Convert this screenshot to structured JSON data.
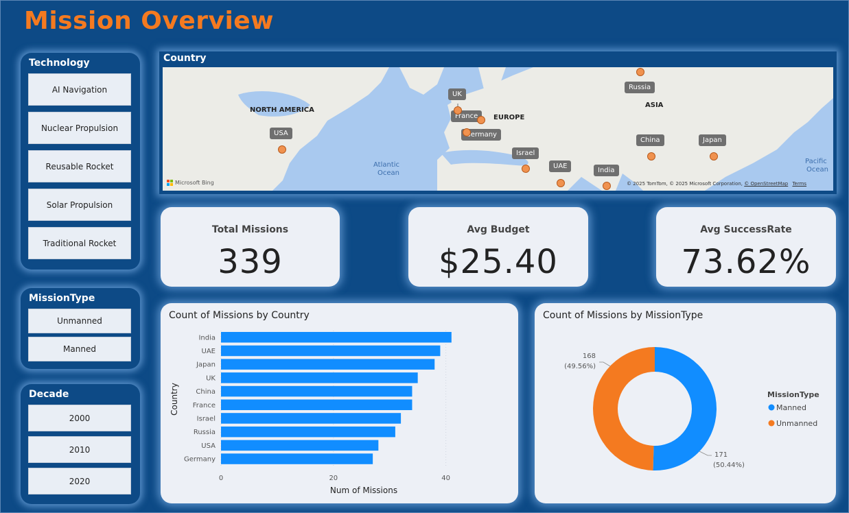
{
  "title": "Mission Overview",
  "slicers": {
    "technology": {
      "header": "Technology",
      "items": [
        "AI Navigation",
        "Nuclear Propulsion",
        "Reusable Rocket",
        "Solar Propulsion",
        "Traditional Rocket"
      ]
    },
    "mission_type": {
      "header": "MissionType",
      "items": [
        "Unmanned",
        "Manned"
      ]
    },
    "decade": {
      "header": "Decade",
      "items": [
        "2000",
        "2010",
        "2020"
      ]
    }
  },
  "map": {
    "header": "Country",
    "regions": [
      "NORTH AMERICA",
      "EUROPE",
      "ASIA"
    ],
    "oceans": [
      "Atlantic",
      "Ocean",
      "Pacific",
      "Ocean"
    ],
    "countries": [
      "UK",
      "France",
      "Germany",
      "Russia",
      "China",
      "Japan",
      "USA",
      "Israel",
      "UAE",
      "India"
    ],
    "provider": "Microsoft Bing",
    "attribution": "© 2025 TomTom, © 2025 Microsoft Corporation,",
    "osm": "© OpenStreetMap",
    "terms": "Terms"
  },
  "kpis": {
    "total_missions": {
      "label": "Total Missions",
      "value": "339"
    },
    "avg_budget": {
      "label": "Avg Budget",
      "value": "$25.40"
    },
    "avg_success": {
      "label": "Avg SuccessRate",
      "value": "73.62%"
    }
  },
  "colors": {
    "background": "#0d4a86",
    "title": "#f47a20",
    "bar": "#118dff",
    "manned": "#118dff",
    "unmanned": "#f47a20",
    "card": "#edf0f6"
  },
  "chart_data": [
    {
      "type": "bar",
      "orientation": "horizontal",
      "title": "Count of Missions by Country",
      "xlabel": "Num of Missions",
      "ylabel": "Country",
      "categories": [
        "India",
        "UAE",
        "Japan",
        "UK",
        "China",
        "France",
        "Israel",
        "Russia",
        "USA",
        "Germany"
      ],
      "values": [
        41,
        39,
        38,
        35,
        34,
        34,
        32,
        31,
        28,
        27
      ],
      "xticks": [
        "0",
        "20",
        "40"
      ],
      "xlim": [
        0,
        42
      ]
    },
    {
      "type": "pie",
      "donut": true,
      "title": "Count of Missions by MissionType",
      "legend_title": "MissionType",
      "categories": [
        "Manned",
        "Unmanned"
      ],
      "values": [
        171,
        168
      ],
      "labels": [
        [
          "171",
          "(50.44%)"
        ],
        [
          "168",
          "(49.56%)"
        ]
      ]
    }
  ]
}
